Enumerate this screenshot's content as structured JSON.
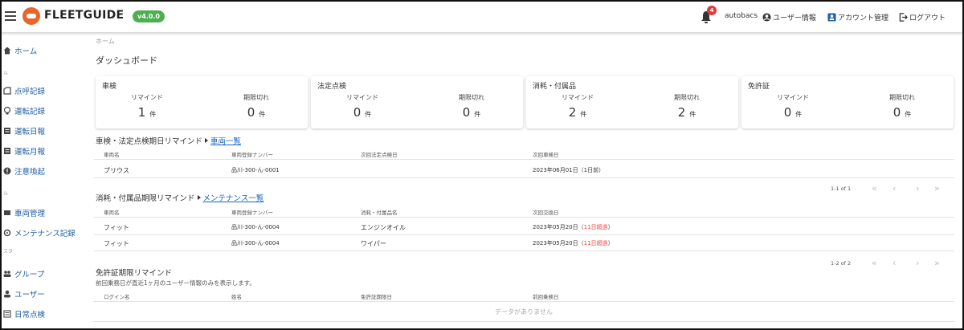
{
  "header": {
    "brand": "FLEETGUIDE",
    "version": "v4.0.0",
    "notification_count": "4",
    "username": "autobacs",
    "links": [
      "ユーザー情報",
      "アカウント管理",
      "ログアウト"
    ]
  },
  "sidebar": {
    "items": [
      "ホーム",
      "点呼記録",
      "運転記録",
      "運転日報",
      "運転月報",
      "注意喚起",
      "車両管理",
      "メンテナンス記録",
      "グループ",
      "ユーザー",
      "日常点検"
    ],
    "section_labels": [
      "ル",
      "ル",
      "ル",
      "スタ"
    ]
  },
  "breadcrumb": "ホーム",
  "page_title": "ダッシュボード",
  "cards": [
    {
      "title": "車検",
      "remind_label": "リマインド",
      "expired_label": "期限切れ",
      "remind": "1",
      "expired": "0",
      "unit": "件"
    },
    {
      "title": "法定点検",
      "remind_label": "リマインド",
      "expired_label": "期限切れ",
      "remind": "0",
      "expired": "0",
      "unit": "件"
    },
    {
      "title": "消耗・付属品",
      "remind_label": "リマインド",
      "expired_label": "期限切れ",
      "remind": "2",
      "expired": "2",
      "unit": "件"
    },
    {
      "title": "免許証",
      "remind_label": "リマインド",
      "expired_label": "期限切れ",
      "remind": "0",
      "expired": "0",
      "unit": "件"
    }
  ],
  "inspection": {
    "title": "車検・法定点検期日リマインド",
    "link": "車両一覧",
    "columns": [
      "車両名",
      "車両登録ナンバー",
      "次回法定点検日",
      "次回車検日"
    ],
    "rows": [
      {
        "name": "プリウス",
        "plate": "品川-300-ん-0001",
        "legal": "",
        "shaken": "2023年06月01日（1日前）"
      }
    ],
    "pager_range": "1-1 of 1"
  },
  "consumables": {
    "title": "消耗・付属品期限リマインド",
    "link": "メンテナンス一覧",
    "columns": [
      "車両名",
      "車両登録ナンバー",
      "消耗・付属品名",
      "次回交換日"
    ],
    "rows": [
      {
        "name": "フィット",
        "plate": "品川-300-ん-0004",
        "item": "エンジンオイル",
        "date": "2023年05月20日（",
        "overdue": "11日超過",
        "close": "）"
      },
      {
        "name": "フィット",
        "plate": "品川-300-ん-0004",
        "item": "ワイパー",
        "date": "2023年05月20日（",
        "overdue": "11日超過",
        "close": "）"
      }
    ],
    "pager_range": "1-2 of 2"
  },
  "license": {
    "title": "免許証期限リマインド",
    "description": "前回乗務日が直近1ヶ月のユーザー情報のみを表示します。",
    "columns": [
      "ログイン名",
      "姓名",
      "免許証期限日",
      "前回乗務日"
    ],
    "empty": "データがありません"
  },
  "pager_icons": [
    "«",
    "‹",
    "›",
    "»"
  ],
  "colors": {
    "brand": "#e8652b",
    "version_badge": "#4caf50",
    "link": "#1565c0",
    "expired": "#f44336"
  }
}
